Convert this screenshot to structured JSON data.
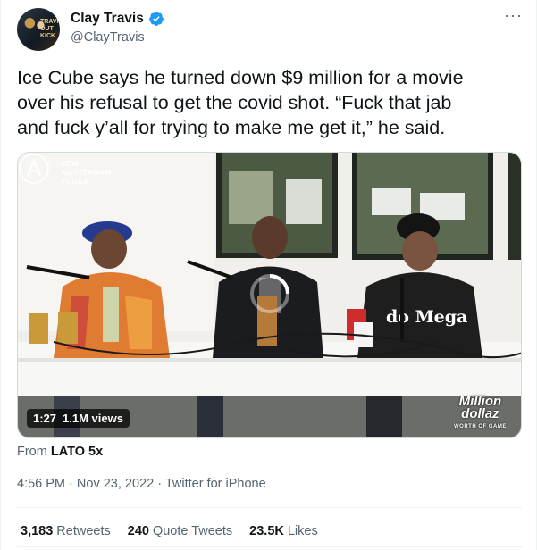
{
  "author": {
    "name": "Clay Travis",
    "handle": "@ClayTravis",
    "verified_icon": "verified-badge-icon",
    "avatar_text": "TRAVIS\nOUT\nKICK"
  },
  "menu": {
    "more_label": "···"
  },
  "tweet": {
    "text": "Ice Cube says he turned down $9 million for a movie\nover his refusal to get the covid shot. “Fuck that jab\nand fuck y’all for trying to make me get it,” he said."
  },
  "media": {
    "duration": "1:27",
    "views": "1.1M views",
    "brand_text": "NEW\nAMSTERDAM\nVODKA",
    "watermark_top": "Million",
    "watermark_mid": "dollaz",
    "watermark_sub": "WORTH OF GAME",
    "shirt_text": "do Mega"
  },
  "source": {
    "prefix": "From",
    "account": "LATO 5x"
  },
  "meta": {
    "time": "4:56 PM",
    "date": "Nov 23, 2022",
    "sep": "·",
    "client": "Twitter for iPhone"
  },
  "stats": {
    "retweets": {
      "count": "3,183",
      "label": "Retweets"
    },
    "quotes": {
      "count": "240",
      "label": "Quote Tweets"
    },
    "likes": {
      "count": "23.5K",
      "label": "Likes"
    }
  },
  "colors": {
    "verified": "#1d9bf0",
    "secondary_text": "#536471",
    "primary_text": "#0f1419"
  }
}
